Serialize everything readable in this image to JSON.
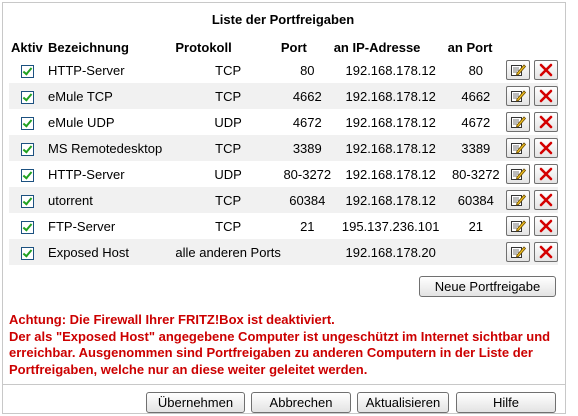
{
  "title": "Liste der Portfreigaben",
  "headers": {
    "aktiv": "Aktiv",
    "bezeichnung": "Bezeichnung",
    "protokoll": "Protokoll",
    "port": "Port",
    "ip": "an IP-Adresse",
    "an_port": "an Port"
  },
  "rows": [
    {
      "aktiv": true,
      "name": "HTTP-Server",
      "protokoll": "TCP",
      "port": "80",
      "ip": "192.168.178.12",
      "an_port": "80"
    },
    {
      "aktiv": true,
      "name": "eMule TCP",
      "protokoll": "TCP",
      "port": "4662",
      "ip": "192.168.178.12",
      "an_port": "4662"
    },
    {
      "aktiv": true,
      "name": "eMule UDP",
      "protokoll": "UDP",
      "port": "4672",
      "ip": "192.168.178.12",
      "an_port": "4672"
    },
    {
      "aktiv": true,
      "name": "MS Remotedesktop",
      "protokoll": "TCP",
      "port": "3389",
      "ip": "192.168.178.12",
      "an_port": "3389"
    },
    {
      "aktiv": true,
      "name": "HTTP-Server",
      "protokoll": "UDP",
      "port": "80-3272",
      "ip": "192.168.178.12",
      "an_port": "80-3272"
    },
    {
      "aktiv": true,
      "name": "utorrent",
      "protokoll": "TCP",
      "port": "60384",
      "ip": "192.168.178.12",
      "an_port": "60384"
    },
    {
      "aktiv": true,
      "name": "FTP-Server",
      "protokoll": "TCP",
      "port": "21",
      "ip": "195.137.236.101",
      "an_port": "21"
    },
    {
      "aktiv": true,
      "name": "Exposed Host",
      "protokoll": "alle anderen Ports",
      "port": "",
      "ip": "192.168.178.20",
      "an_port": ""
    }
  ],
  "icons": {
    "edit": "edit-icon",
    "delete": "delete-icon"
  },
  "neue_button": "Neue Portfreigabe",
  "warning": {
    "line1": "Achtung: Die Firewall Ihrer FRITZ!Box ist deaktiviert.",
    "line2": "Der als \"Exposed Host\" angegebene Computer ist ungeschützt im Internet sichtbar und erreichbar. Ausgenommen sind Portfreigaben zu anderen Computern in der Liste der Portfreigaben, welche nur an diese weiter geleitet werden."
  },
  "footer": {
    "uebernehmen": "Übernehmen",
    "abbrechen": "Abbrechen",
    "aktualisieren": "Aktualisieren",
    "hilfe": "Hilfe"
  },
  "colors": {
    "warning": "#cc0000",
    "check": "#21a121",
    "delete": "#d40000",
    "row_alt": "#f1f1f1"
  }
}
